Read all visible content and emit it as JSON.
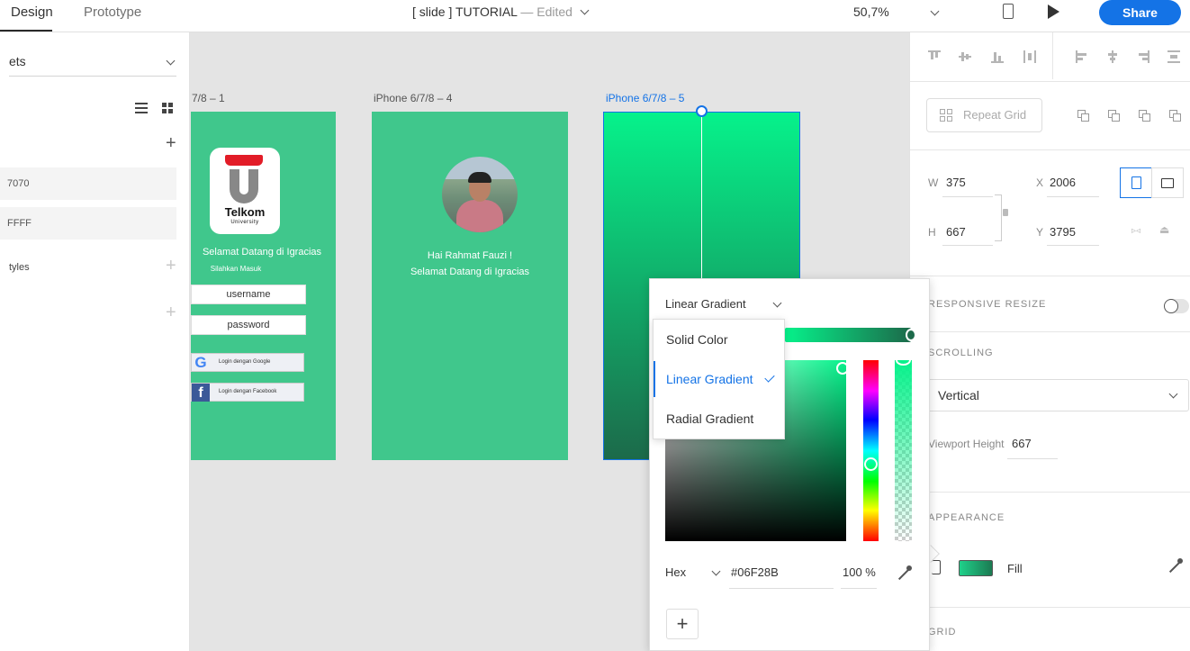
{
  "topbar": {
    "tabs": [
      {
        "label": "Design"
      },
      {
        "label": "Prototype"
      }
    ],
    "doc_title": "[ slide ] TUTORIAL",
    "doc_status": "— Edited",
    "zoom": "50,7%",
    "share_label": "Share"
  },
  "left_panel": {
    "assets_label": "ets",
    "colors": [
      "7070",
      "FFFF"
    ],
    "styles_label": "tyles"
  },
  "canvas": {
    "artboards": [
      {
        "label": "7/8 – 1"
      },
      {
        "label": "iPhone 6/7/8 – 4"
      },
      {
        "label": "iPhone 6/7/8 – 5"
      }
    ],
    "login": {
      "logo_text": "Telkom",
      "logo_sub": "University",
      "welcome": "Selamat Datang di Igracias",
      "subtitle": "Silahkan Masuk",
      "username": "username",
      "password": "password",
      "google_btn": "Login dengan Google",
      "facebook_btn": "Login dengan Facebook"
    },
    "profile": {
      "greeting": "Hai Rahmat Fauzi !",
      "welcome": "Selamat Datang di Igracias"
    }
  },
  "right_panel": {
    "repeat_grid_label": "Repeat Grid",
    "w_label": "W",
    "w_value": "375",
    "h_label": "H",
    "h_value": "667",
    "x_label": "X",
    "x_value": "2006",
    "y_label": "Y",
    "y_value": "3795",
    "responsive_resize": "RESPONSIVE RESIZE",
    "scrolling": "SCROLLING",
    "scroll_value": "Vertical",
    "viewport_label": "Viewport Height",
    "viewport_value": "667",
    "appearance": "APPEARANCE",
    "fill_label": "Fill",
    "grid_label": "GRID"
  },
  "picker": {
    "type": "Linear Gradient",
    "menu": [
      "Solid Color",
      "Linear Gradient",
      "Radial Gradient"
    ],
    "selected_index": 1,
    "hex_label": "Hex",
    "hex_value": "#06F28B",
    "opacity": "100 %"
  },
  "colors": {
    "accent": "#1473e6",
    "artboard_green": "#40c78c",
    "gradient_start": "#06f28b",
    "gradient_end": "#1c6a4a"
  }
}
